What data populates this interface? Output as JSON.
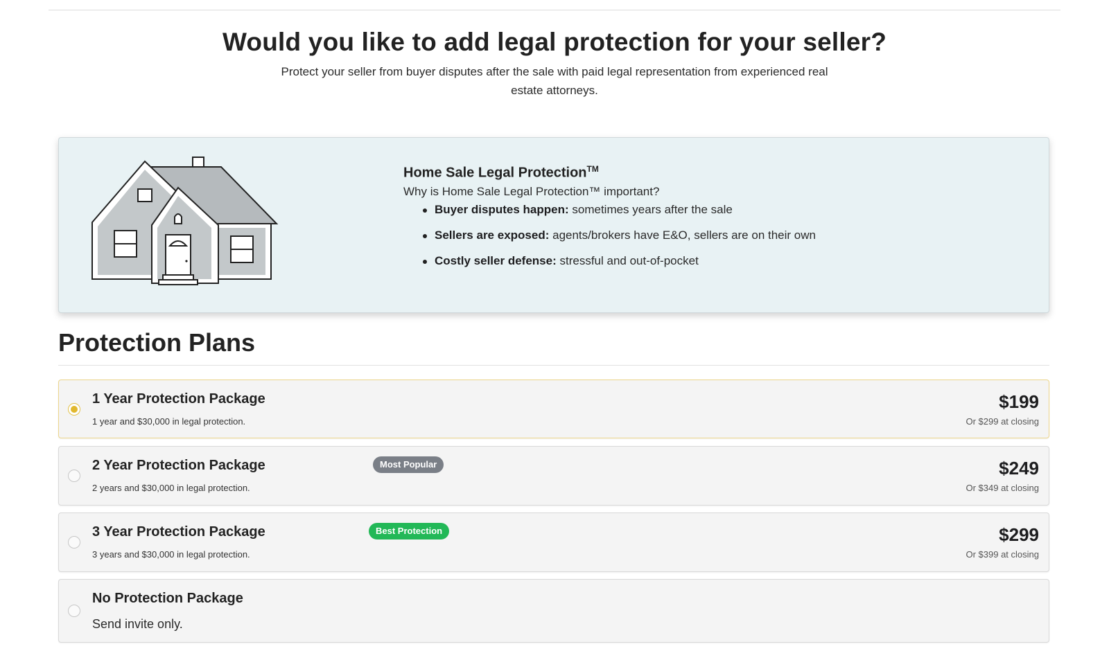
{
  "header": {
    "title": "Would you like to add legal protection for your seller?",
    "subtitle": "Protect your seller from buyer disputes after the sale with paid legal representation from experienced real estate attorneys."
  },
  "info_card": {
    "title": "Home Sale Legal Protection",
    "trademark": "TM",
    "question": "Why is Home Sale Legal Protection™ important?",
    "bullets": [
      {
        "bold": "Buyer disputes happen:",
        "text": "sometimes years after the sale"
      },
      {
        "bold": "Sellers are exposed:",
        "text": "agents/brokers have E&O, sellers are on their own"
      },
      {
        "bold": "Costly seller defense:",
        "text": "stressful and out-of-pocket"
      }
    ],
    "image_icon": "house-illustration"
  },
  "plans": {
    "heading": "Protection Plans",
    "items": [
      {
        "name": "1 Year Protection Package",
        "description": "1 year and $30,000 in legal protection.",
        "price": "$199",
        "price_alt": "Or $299 at closing",
        "badge": "",
        "selected": true
      },
      {
        "name": "2 Year Protection Package",
        "description": "2 years and $30,000 in legal protection.",
        "price": "$249",
        "price_alt": "Or $349 at closing",
        "badge": "Most Popular",
        "selected": false
      },
      {
        "name": "3 Year Protection Package",
        "description": "3 years and $30,000 in legal protection.",
        "price": "$299",
        "price_alt": "Or $399 at closing",
        "badge": "Best Protection",
        "selected": false
      },
      {
        "name": "No Protection Package",
        "description": "Send invite only.",
        "selected": false
      }
    ]
  },
  "colors": {
    "info_bg": "#e8f2f4",
    "selected_radio": "#e1b82e",
    "badge_gray": "#7a7f87",
    "badge_green": "#22b857"
  }
}
